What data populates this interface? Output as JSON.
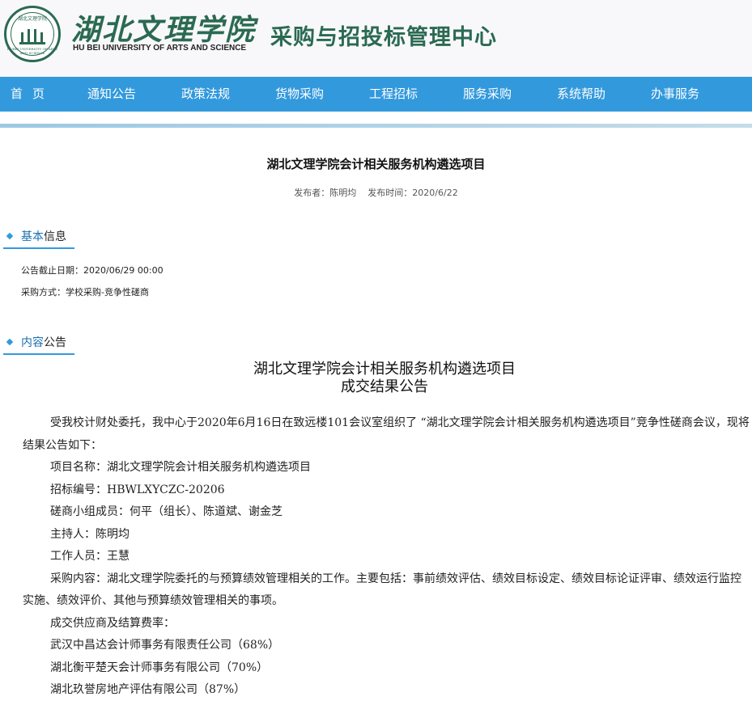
{
  "header": {
    "school_name_cn": "湖北文理学院",
    "school_name_en": "HU BEI UNIVERSITY OF ARTS AND SCIENCE",
    "center_name": "采购与招投标管理中心",
    "seal_top_text": "湖北文理学院",
    "seal_bottom_text": "HUBEI UNIVERSITY OF ARTS AND SCIENCE",
    "brand_color": "#2b6a52"
  },
  "nav": {
    "items": [
      "首页",
      "通知公告",
      "政策法规",
      "货物采购",
      "工程招标",
      "服务采购",
      "系统帮助",
      "办事服务"
    ],
    "color": "#3399dd"
  },
  "article": {
    "title": "湖北文理学院会计相关服务机构遴选项目",
    "publisher_label": "发布者：",
    "publisher": "陈明均",
    "time_label": "发布时间：",
    "time": "2020/6/22"
  },
  "basic_info": {
    "heading_hl": "基本",
    "heading_rest": "信息",
    "deadline_label": "公告截止日期：",
    "deadline": "2020/06/29 00:00",
    "method_label": "采购方式：",
    "method": "学校采购-竞争性磋商"
  },
  "content": {
    "heading_hl": "内容",
    "heading_rest": "公告",
    "title_line1": "湖北文理学院会计相关服务机构遴选项目",
    "title_line2": "成交结果公告",
    "paragraphs": [
      "受我校计财处委托，我中心于2020年6月16日在致远楼101会议室组织了 “湖北文理学院会计相关服务机构遴选项目”竞争性磋商会议，现将结果公告如下：",
      "项目名称：湖北文理学院会计相关服务机构遴选项目",
      "招标编号：HBWLXYCZC-20206",
      "磋商小组成员：何平（组长）、陈道斌、谢金芝",
      "主持人：陈明均",
      "工作人员：王慧",
      "采购内容：湖北文理学院委托的与预算绩效管理相关的工作。主要包括：事前绩效评估、绩效目标设定、绩效目标论证评审、绩效运行监控实施、绩效评价、其他与预算绩效管理相关的事项。",
      "成交供应商及结算费率：",
      "武汉中昌达会计师事务有限责任公司（68%）",
      "湖北衡平楚天会计师事务有限公司（70%）",
      "湖北玖誉房地产评估有限公司（87%）"
    ]
  }
}
